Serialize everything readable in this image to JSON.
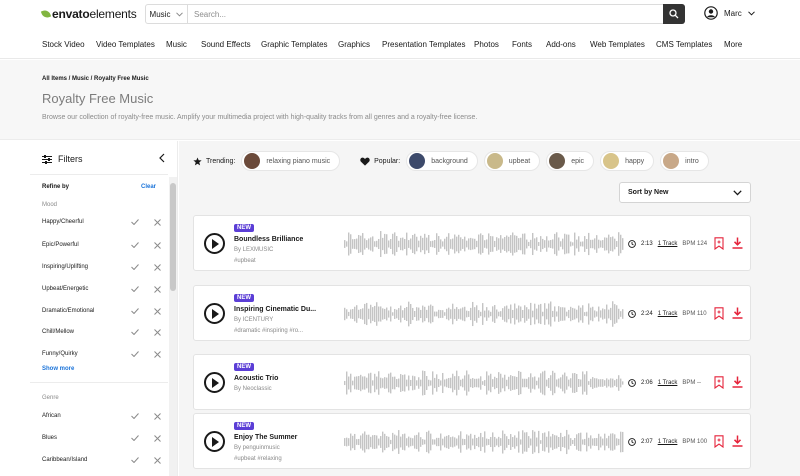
{
  "header": {
    "logo_bold": "envato",
    "logo_soft": "elements",
    "search_category": "Music",
    "search_placeholder": "Search...",
    "user_name": "Marc"
  },
  "nav": {
    "items": [
      "Stock Video",
      "Video Templates",
      "Music",
      "Sound Effects",
      "Graphic Templates",
      "Graphics",
      "Presentation Templates",
      "Photos",
      "Fonts",
      "Add-ons",
      "Web Templates",
      "CMS Templates",
      "More"
    ]
  },
  "hero": {
    "breadcrumb": "All Items / Music / Royalty Free Music",
    "title": "Royalty Free Music",
    "description": "Browse our collection of royalty-free music. Amplify your multimedia project with high-quality tracks from all genres and a royalty-free license."
  },
  "sidebar": {
    "title": "Filters",
    "refine_by": "Refine by",
    "clear": "Clear",
    "mood_title": "Mood",
    "moods": [
      "Happy/Cheerful",
      "Epic/Powerful",
      "Inspiring/Uplifting",
      "Upbeat/Energetic",
      "Dramatic/Emotional",
      "Chill/Mellow",
      "Funny/Quirky"
    ],
    "show_more": "Show more",
    "genre_title": "Genre",
    "genres": [
      "African",
      "Blues",
      "Caribbean/Island"
    ]
  },
  "tags": {
    "trending_label": "Trending:",
    "trending": [
      {
        "label": "relaxing piano music",
        "color": "#6b4a3a"
      }
    ],
    "popular_label": "Popular:",
    "popular": [
      {
        "label": "background",
        "color": "#3d4a6b"
      },
      {
        "label": "upbeat",
        "color": "#c9b98a"
      },
      {
        "label": "epic",
        "color": "#6a5a4a"
      },
      {
        "label": "happy",
        "color": "#d8c48a"
      },
      {
        "label": "intro",
        "color": "#c8a888"
      }
    ]
  },
  "sort": {
    "label": "Sort by New"
  },
  "tracks": [
    {
      "badge": "NEW",
      "title": "Boundless Brilliance",
      "author": "By LEXMUSIC",
      "tags": "#upbeat",
      "duration": "2:13",
      "track_count": "1 Track",
      "bpm": "BPM 124"
    },
    {
      "badge": "NEW",
      "title": "Inspiring Cinematic Du...",
      "author": "By ICENTURY",
      "tags": "#dramatic #inspiring #ro...",
      "duration": "2:24",
      "track_count": "1 Track",
      "bpm": "BPM 110"
    },
    {
      "badge": "NEW",
      "title": "Acoustic Trio",
      "author": "By Neoclassic",
      "tags": "",
      "duration": "2:06",
      "track_count": "1 Track",
      "bpm": "BPM --"
    },
    {
      "badge": "NEW",
      "title": "Enjoy The Summer",
      "author": "By penguinmusic",
      "tags": "#upbeat #relaxing",
      "duration": "2:07",
      "track_count": "1 Track",
      "bpm": "BPM 100"
    }
  ],
  "colors": {
    "accent_red": "#e5243b",
    "badge_purple": "#5b3ed6",
    "link_blue": "#1a73d9",
    "brand_green": "#82b541",
    "wave_gray": "#c4c4c4"
  }
}
